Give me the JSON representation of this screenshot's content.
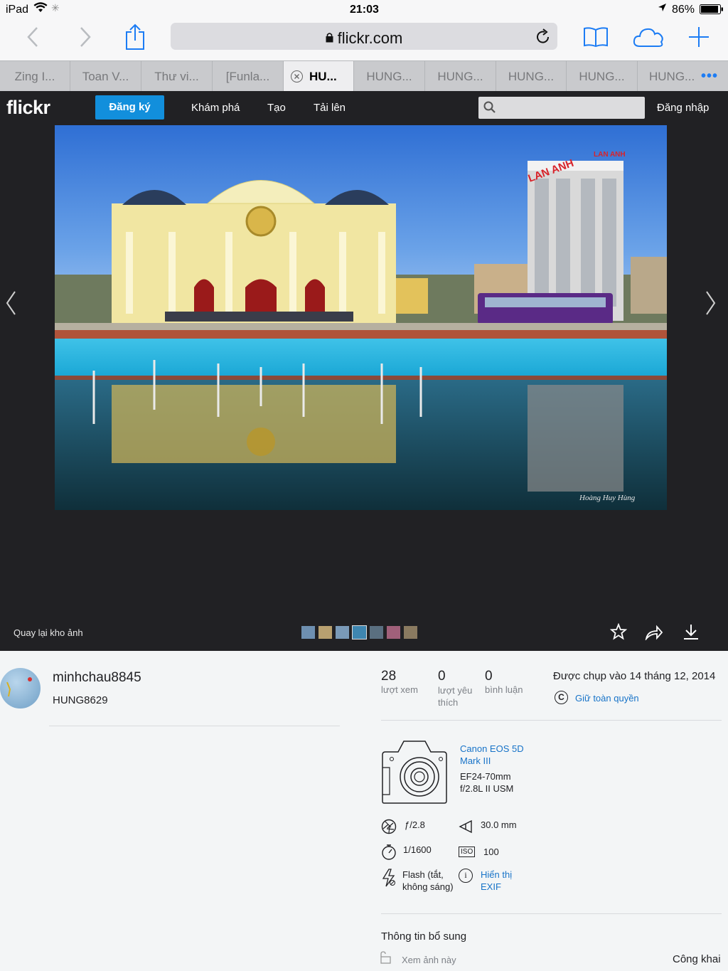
{
  "status": {
    "device": "iPad",
    "time": "21:03",
    "battery": "86%"
  },
  "browser": {
    "url": "flickr.com",
    "tabs": [
      "Zing I...",
      "Toan V...",
      "Thư vi...",
      "[Funla...",
      "HU...",
      "HUNG...",
      "HUNG...",
      "HUNG...",
      "HUNG...",
      "HUNG..."
    ]
  },
  "header": {
    "logo": "flickr",
    "signup": "Đăng ký",
    "nav": [
      "Khám phá",
      "Tạo",
      "Tải lên"
    ],
    "login": "Đăng nhập"
  },
  "photo": {
    "building_sign_1": "LAN ANH",
    "building_sign_2": "LAN ANH",
    "watermark": "Hoàng Huy Hùng"
  },
  "photo_bar": {
    "back_label": "Quay lại kho ảnh"
  },
  "owner": {
    "username": "minhchau8845",
    "title": "HUNG8629"
  },
  "stats": [
    {
      "value": "28",
      "label": "lượt xem"
    },
    {
      "value": "0",
      "label": "lượt yêu thích"
    },
    {
      "value": "0",
      "label": "bình luận"
    }
  ],
  "taken": {
    "date_label": "Được chụp vào 14 tháng 12, 2014",
    "license": "Giữ toàn quyền"
  },
  "camera": {
    "model": "Canon EOS 5D Mark III",
    "lens": "EF24-70mm f/2.8L II USM",
    "aperture": "ƒ/2.8",
    "focal": "30.0 mm",
    "shutter": "1/1600",
    "iso_badge": "ISO",
    "iso": "100",
    "flash": "Flash (tắt, không sáng)",
    "exif_link": "Hiển thị EXIF"
  },
  "additional": {
    "heading": "Thông tin bổ sung",
    "view_label": "Xem ảnh này",
    "visibility": "Công khai"
  },
  "colors": {
    "flickr_blue": "#128fdc",
    "ios_blue": "#1c7cf4",
    "header_bg": "#212124",
    "link_blue": "#1773c8"
  }
}
